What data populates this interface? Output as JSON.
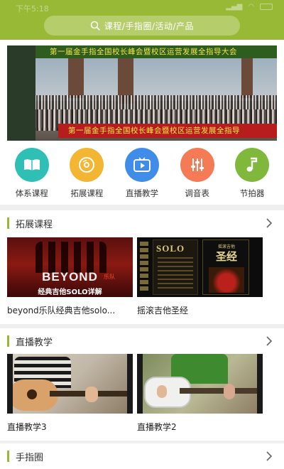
{
  "status_bar": {
    "time": "下午5:18"
  },
  "search": {
    "placeholder": "课程/手指圈/活动/产品",
    "icon": "search-icon"
  },
  "banner": {
    "top_text": "第一届金手指全国校长峰会暨校区运营发展全指导大会",
    "bottom_text": "第一届金手指全国校长峰会暨校区运营发展全指导"
  },
  "menu": [
    {
      "label": "体系课程",
      "icon": "book-icon",
      "color": "#2fbfb5"
    },
    {
      "label": "拓展课程",
      "icon": "disc-icon",
      "color": "#f2b632"
    },
    {
      "label": "直播教学",
      "icon": "tv-play-icon",
      "color": "#3f8de8"
    },
    {
      "label": "调音表",
      "icon": "tuner-sliders-icon",
      "color": "#f47b55"
    },
    {
      "label": "节拍器",
      "icon": "music-note-icon",
      "color": "#7fb83a"
    }
  ],
  "sections": {
    "extension": {
      "title": "拓展课程",
      "items": [
        {
          "title": "beyond乐队经典吉他solo...",
          "thumb_logo": "BEYOND",
          "thumb_logo_tag": "乐队",
          "thumb_caption": "经典吉他SOLO详解"
        },
        {
          "title": "摇滚吉他圣经",
          "thumb_book1": "SOLO",
          "thumb_book2_sub": "摇滚吉他",
          "thumb_book2_title": "圣经"
        }
      ]
    },
    "live": {
      "title": "直播教学",
      "items": [
        {
          "title": "直播教学3"
        },
        {
          "title": "直播教学2"
        }
      ]
    },
    "finger": {
      "title": "手指圈"
    }
  },
  "colors": {
    "brand": "#97b936",
    "search_bg": "#b6cd6c"
  }
}
